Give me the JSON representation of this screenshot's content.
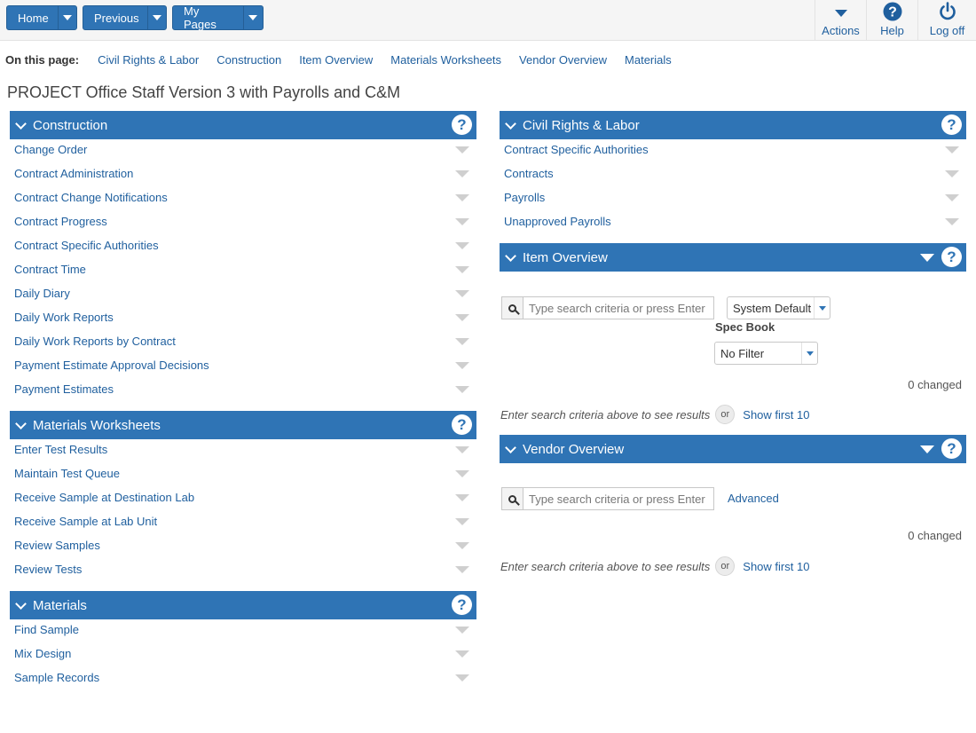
{
  "topbar": {
    "home": "Home",
    "previous": "Previous",
    "mypages": "My Pages",
    "actions": "Actions",
    "help": "Help",
    "logoff": "Log off"
  },
  "on_this_page": {
    "label": "On this page:",
    "links": [
      "Civil Rights & Labor",
      "Construction",
      "Item Overview",
      "Materials Worksheets",
      "Vendor Overview",
      "Materials"
    ]
  },
  "page_title": "PROJECT Office Staff Version 3 with Payrolls and C&M",
  "help_glyph": "?",
  "panels": {
    "construction": {
      "title": "Construction",
      "items": [
        "Change Order",
        "Contract Administration",
        "Contract Change Notifications",
        "Contract Progress",
        "Contract Specific Authorities",
        "Contract Time",
        "Daily Diary",
        "Daily Work Reports",
        "Daily Work Reports by Contract",
        "Payment Estimate Approval Decisions",
        "Payment Estimates"
      ]
    },
    "materials_worksheets": {
      "title": "Materials Worksheets",
      "items": [
        "Enter Test Results",
        "Maintain Test Queue",
        "Receive Sample at Destination Lab",
        "Receive Sample at Lab Unit",
        "Review Samples",
        "Review Tests"
      ]
    },
    "materials": {
      "title": "Materials",
      "items": [
        "Find Sample",
        "Mix Design",
        "Sample Records"
      ]
    },
    "civil_rights": {
      "title": "Civil Rights & Labor",
      "items": [
        "Contract Specific Authorities",
        "Contracts",
        "Payrolls",
        "Unapproved Payrolls"
      ]
    },
    "item_overview": {
      "title": "Item Overview",
      "search_placeholder": "Type search criteria or press Enter",
      "filter_value": "System Default",
      "spec_book_label": "Spec Book",
      "spec_book_value": "No Filter",
      "changed": "0 changed",
      "hint": "Enter search criteria above to see results",
      "or": "or",
      "show_first": "Show first 10"
    },
    "vendor_overview": {
      "title": "Vendor Overview",
      "search_placeholder": "Type search criteria or press Enter",
      "advanced": "Advanced",
      "changed": "0 changed",
      "hint": "Enter search criteria above to see results",
      "or": "or",
      "show_first": "Show first 10"
    }
  },
  "colors": {
    "accent": "#2f74b5",
    "link": "#1f5f9e"
  }
}
